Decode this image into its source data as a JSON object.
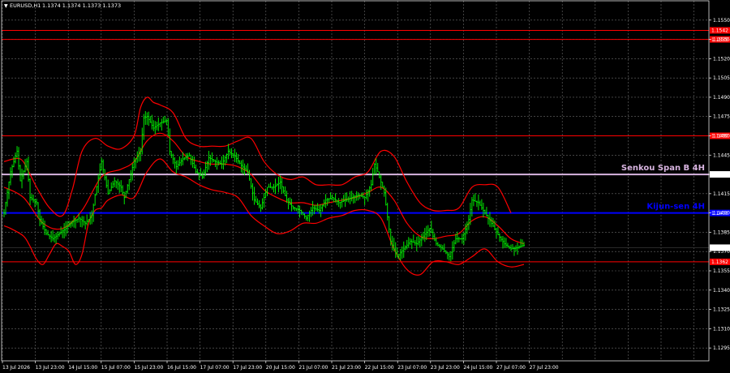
{
  "header": {
    "symbol": "EURUSD,H1",
    "quote": "1.1374 1.1374 1.1373 1.1373"
  },
  "colors": {
    "background": "#000000",
    "grid": "#6b6b6b",
    "price": "#00ff00",
    "bands": "#ff0000",
    "resistance": "#ff0000",
    "senkou": "#d8b4e0",
    "kijun": "#0000ff",
    "axis_tag": "#ff0000",
    "current": "#2f2f2f"
  },
  "chart_data": {
    "type": "line",
    "title": "EURUSD,H1",
    "ylim": [
      1.1285,
      1.1565
    ],
    "y_ticks": [
      "1.1550",
      "1.1535",
      "1.1520",
      "1.1505",
      "1.1490",
      "1.1475",
      "1.1460",
      "1.1445",
      "1.1430",
      "1.1415",
      "1.1400",
      "1.1385",
      "1.1370",
      "1.1355",
      "1.1340",
      "1.1325",
      "1.1310",
      "1.1295"
    ],
    "x_ticks": [
      "13 Jul 2026",
      "13 Jul 23:00",
      "14 Jul 15:00",
      "15 Jul 07:00",
      "15 Jul 23:00",
      "16 Jul 15:00",
      "17 Jul 07:00",
      "17 Jul 23:00",
      "20 Jul 15:00",
      "21 Jul 07:00",
      "21 Jul 23:00",
      "22 Jul 15:00",
      "23 Jul 07:00",
      "23 Jul 23:00",
      "24 Jul 15:00",
      "27 Jul 07:00",
      "27 Jul 23:00"
    ],
    "levels": [
      {
        "label": "1.1542",
        "value": 1.1542,
        "kind": "resistance"
      },
      {
        "label": "1.1535",
        "value": 1.1535,
        "kind": "resistance"
      },
      {
        "label": "1.1460",
        "value": 1.146,
        "kind": "resistance"
      },
      {
        "label": "1.1430",
        "value": 1.143,
        "kind": "senkou",
        "name": "Senkou Span B 4H"
      },
      {
        "label": "1.1400",
        "value": 1.14,
        "kind": "kijun",
        "name": "Kijun-sen 4H"
      },
      {
        "label": "1.1362",
        "value": 1.1362,
        "kind": "resistance"
      }
    ],
    "current_price": {
      "label": "1.1373",
      "value": 1.1373
    },
    "price_path": [
      [
        0,
        1.14
      ],
      [
        2,
        1.1432
      ],
      [
        4,
        1.1448
      ],
      [
        5,
        1.1425
      ],
      [
        7,
        1.144
      ],
      [
        8,
        1.1412
      ],
      [
        10,
        1.1408
      ],
      [
        11,
        1.1395
      ],
      [
        13,
        1.1384
      ],
      [
        15,
        1.138
      ],
      [
        17,
        1.1384
      ],
      [
        19,
        1.1388
      ],
      [
        21,
        1.1393
      ],
      [
        23,
        1.1396
      ],
      [
        25,
        1.1392
      ],
      [
        27,
        1.1398
      ],
      [
        28,
        1.1414
      ],
      [
        30,
        1.144
      ],
      [
        32,
        1.1415
      ],
      [
        34,
        1.1425
      ],
      [
        36,
        1.142
      ],
      [
        37,
        1.1412
      ],
      [
        40,
        1.144
      ],
      [
        42,
        1.1448
      ],
      [
        43,
        1.1474
      ],
      [
        44,
        1.1475
      ],
      [
        46,
        1.1466
      ],
      [
        48,
        1.147
      ],
      [
        50,
        1.1472
      ],
      [
        51,
        1.1448
      ],
      [
        53,
        1.1436
      ],
      [
        55,
        1.1442
      ],
      [
        57,
        1.1445
      ],
      [
        59,
        1.1432
      ],
      [
        61,
        1.1428
      ],
      [
        63,
        1.1443
      ],
      [
        65,
        1.144
      ],
      [
        67,
        1.1438
      ],
      [
        69,
        1.1448
      ],
      [
        71,
        1.1444
      ],
      [
        73,
        1.1437
      ],
      [
        75,
        1.1432
      ],
      [
        77,
        1.141
      ],
      [
        79,
        1.1404
      ],
      [
        81,
        1.142
      ],
      [
        83,
        1.142
      ],
      [
        85,
        1.1424
      ],
      [
        87,
        1.141
      ],
      [
        89,
        1.1404
      ],
      [
        91,
        1.1402
      ],
      [
        93,
        1.1396
      ],
      [
        95,
        1.1404
      ],
      [
        97,
        1.1402
      ],
      [
        99,
        1.141
      ],
      [
        101,
        1.1412
      ],
      [
        103,
        1.1408
      ],
      [
        105,
        1.141
      ],
      [
        107,
        1.1412
      ],
      [
        109,
        1.1414
      ],
      [
        111,
        1.1412
      ],
      [
        113,
        1.1422
      ],
      [
        114,
        1.1438
      ],
      [
        115,
        1.1432
      ],
      [
        117,
        1.1416
      ],
      [
        119,
        1.1378
      ],
      [
        121,
        1.1366
      ],
      [
        123,
        1.1372
      ],
      [
        125,
        1.1378
      ],
      [
        127,
        1.1376
      ],
      [
        129,
        1.1382
      ],
      [
        131,
        1.1388
      ],
      [
        133,
        1.1376
      ],
      [
        135,
        1.1372
      ],
      [
        137,
        1.1366
      ],
      [
        139,
        1.138
      ],
      [
        141,
        1.138
      ],
      [
        143,
        1.1395
      ],
      [
        144,
        1.141
      ],
      [
        146,
        1.1408
      ],
      [
        148,
        1.14
      ],
      [
        150,
        1.1392
      ],
      [
        152,
        1.1383
      ],
      [
        154,
        1.1376
      ],
      [
        156,
        1.1372
      ],
      [
        158,
        1.1373
      ],
      [
        160,
        1.1375
      ]
    ],
    "upper_band": [
      [
        0,
        1.144
      ],
      [
        5,
        1.1442
      ],
      [
        8,
        1.143
      ],
      [
        10,
        1.142
      ],
      [
        14,
        1.1404
      ],
      [
        18,
        1.1398
      ],
      [
        21,
        1.1418
      ],
      [
        24,
        1.1448
      ],
      [
        28,
        1.1458
      ],
      [
        32,
        1.1452
      ],
      [
        36,
        1.145
      ],
      [
        40,
        1.146
      ],
      [
        42,
        1.1482
      ],
      [
        44,
        1.149
      ],
      [
        46,
        1.1486
      ],
      [
        48,
        1.1484
      ],
      [
        52,
        1.1478
      ],
      [
        56,
        1.1458
      ],
      [
        60,
        1.1452
      ],
      [
        64,
        1.1452
      ],
      [
        68,
        1.1452
      ],
      [
        72,
        1.1456
      ],
      [
        76,
        1.1458
      ],
      [
        80,
        1.144
      ],
      [
        84,
        1.143
      ],
      [
        88,
        1.1426
      ],
      [
        92,
        1.1428
      ],
      [
        96,
        1.1422
      ],
      [
        100,
        1.1422
      ],
      [
        104,
        1.1422
      ],
      [
        108,
        1.1428
      ],
      [
        112,
        1.1432
      ],
      [
        116,
        1.1448
      ],
      [
        120,
        1.1444
      ],
      [
        124,
        1.1424
      ],
      [
        128,
        1.1408
      ],
      [
        132,
        1.1402
      ],
      [
        136,
        1.1402
      ],
      [
        140,
        1.1404
      ],
      [
        144,
        1.142
      ],
      [
        148,
        1.1422
      ],
      [
        152,
        1.142
      ],
      [
        156,
        1.14
      ]
    ],
    "lower_band": [
      [
        0,
        1.139
      ],
      [
        2,
        1.1388
      ],
      [
        6,
        1.1382
      ],
      [
        8,
        1.1374
      ],
      [
        10,
        1.1364
      ],
      [
        12,
        1.136
      ],
      [
        14,
        1.1368
      ],
      [
        16,
        1.1376
      ],
      [
        18,
        1.1374
      ],
      [
        20,
        1.137
      ],
      [
        22,
        1.136
      ],
      [
        24,
        1.1368
      ],
      [
        26,
        1.1392
      ],
      [
        28,
        1.1402
      ],
      [
        30,
        1.1404
      ],
      [
        32,
        1.141
      ],
      [
        36,
        1.1414
      ],
      [
        40,
        1.1412
      ],
      [
        44,
        1.1432
      ],
      [
        48,
        1.1442
      ],
      [
        52,
        1.1432
      ],
      [
        56,
        1.1428
      ],
      [
        60,
        1.1422
      ],
      [
        64,
        1.1418
      ],
      [
        68,
        1.1416
      ],
      [
        72,
        1.1412
      ],
      [
        76,
        1.1398
      ],
      [
        80,
        1.139
      ],
      [
        84,
        1.1384
      ],
      [
        88,
        1.1386
      ],
      [
        92,
        1.1392
      ],
      [
        96,
        1.1392
      ],
      [
        100,
        1.1396
      ],
      [
        104,
        1.1398
      ],
      [
        108,
        1.1402
      ],
      [
        112,
        1.1402
      ],
      [
        116,
        1.1396
      ],
      [
        120,
        1.1372
      ],
      [
        124,
        1.1356
      ],
      [
        128,
        1.1352
      ],
      [
        132,
        1.1362
      ],
      [
        136,
        1.1362
      ],
      [
        140,
        1.136
      ],
      [
        144,
        1.1366
      ],
      [
        148,
        1.1372
      ],
      [
        152,
        1.1362
      ],
      [
        156,
        1.1358
      ],
      [
        160,
        1.136
      ]
    ],
    "mid_line": [
      [
        0,
        1.142
      ],
      [
        6,
        1.1412
      ],
      [
        12,
        1.1392
      ],
      [
        18,
        1.1388
      ],
      [
        24,
        1.1402
      ],
      [
        30,
        1.1428
      ],
      [
        36,
        1.1434
      ],
      [
        40,
        1.144
      ],
      [
        44,
        1.1456
      ],
      [
        48,
        1.1462
      ],
      [
        52,
        1.1456
      ],
      [
        56,
        1.1444
      ],
      [
        60,
        1.144
      ],
      [
        64,
        1.1438
      ],
      [
        68,
        1.1438
      ],
      [
        72,
        1.1436
      ],
      [
        76,
        1.143
      ],
      [
        80,
        1.1418
      ],
      [
        84,
        1.1412
      ],
      [
        88,
        1.1408
      ],
      [
        92,
        1.1408
      ],
      [
        96,
        1.1406
      ],
      [
        100,
        1.1408
      ],
      [
        104,
        1.141
      ],
      [
        108,
        1.1412
      ],
      [
        112,
        1.1416
      ],
      [
        116,
        1.142
      ],
      [
        120,
        1.141
      ],
      [
        124,
        1.1392
      ],
      [
        128,
        1.1382
      ],
      [
        132,
        1.138
      ],
      [
        136,
        1.1382
      ],
      [
        140,
        1.1384
      ],
      [
        144,
        1.1394
      ],
      [
        148,
        1.1397
      ],
      [
        152,
        1.139
      ],
      [
        156,
        1.138
      ],
      [
        160,
        1.1376
      ]
    ]
  }
}
